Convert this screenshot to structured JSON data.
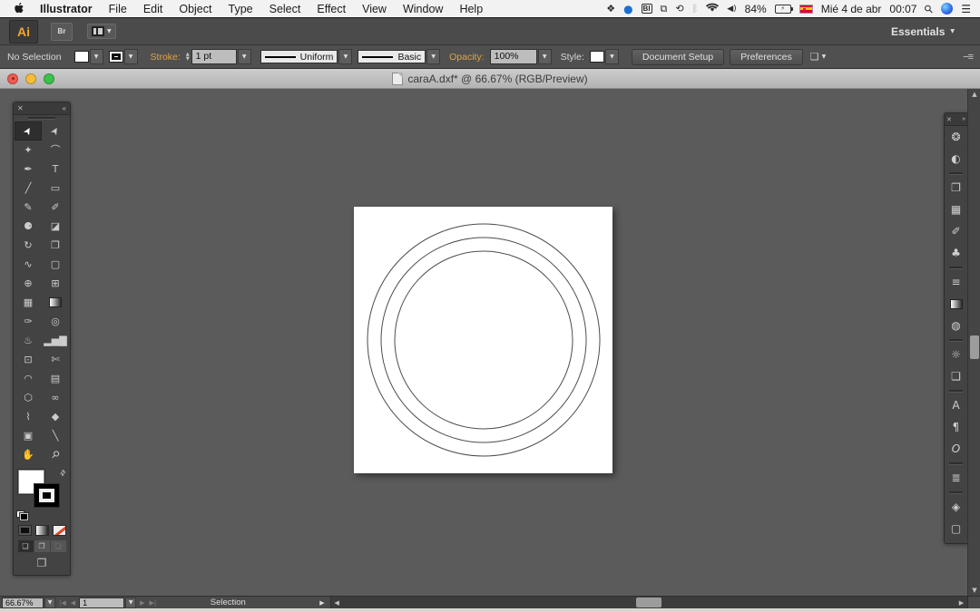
{
  "menu_bar": {
    "items": [
      "Illustrator",
      "File",
      "Edit",
      "Object",
      "Type",
      "Select",
      "Effect",
      "View",
      "Window",
      "Help"
    ],
    "status": {
      "bi": "BI",
      "battery": "84%",
      "date": "Mié 4 de abr",
      "time": "00:07",
      "icons": {
        "dropbox": "❖",
        "app": "●",
        "displays": "⧉",
        "time_machine": "⟲",
        "bluetooth": "ᛒ",
        "volume": "◀)",
        "list": "☰",
        "search": "⚲"
      }
    }
  },
  "app_bar": {
    "logo": "Ai",
    "bridge": "Br",
    "workspace_label": "Essentials"
  },
  "control_bar": {
    "no_selection": "No Selection",
    "stroke_label": "Stroke:",
    "stroke_value": "1 pt",
    "profile": "Uniform",
    "brush": "Basic",
    "opacity_label": "Opacity:",
    "opacity_value": "100%",
    "style_label": "Style:",
    "document_setup": "Document Setup",
    "preferences": "Preferences",
    "accent_color": "#e3a340"
  },
  "document": {
    "title": "caraA.dxf* @ 66.67% (RGB/Preview)"
  },
  "tools": [
    {
      "name": "selection-tool",
      "glyph": "➤",
      "rot": -60,
      "selected": true
    },
    {
      "name": "direct-selection-tool",
      "glyph": "➤",
      "rot": -60
    },
    {
      "name": "magic-wand-tool",
      "glyph": "✦"
    },
    {
      "name": "lasso-tool",
      "glyph": "⌒"
    },
    {
      "name": "pen-tool",
      "glyph": "✒"
    },
    {
      "name": "type-tool",
      "glyph": "T"
    },
    {
      "name": "line-segment-tool",
      "glyph": "╱"
    },
    {
      "name": "rectangle-tool",
      "glyph": "▭"
    },
    {
      "name": "paintbrush-tool",
      "glyph": "✎"
    },
    {
      "name": "pencil-tool",
      "glyph": "✐"
    },
    {
      "name": "blob-brush-tool",
      "glyph": "⚈"
    },
    {
      "name": "eraser-tool",
      "glyph": "◪"
    },
    {
      "name": "rotate-tool",
      "glyph": "↻"
    },
    {
      "name": "scale-tool",
      "glyph": "❐"
    },
    {
      "name": "width-tool",
      "glyph": "∿"
    },
    {
      "name": "free-transform-tool",
      "glyph": "▢"
    },
    {
      "name": "shape-builder-tool",
      "glyph": "⊕"
    },
    {
      "name": "perspective-grid-tool",
      "glyph": "⊞"
    },
    {
      "name": "mesh-tool",
      "glyph": "▦"
    },
    {
      "name": "gradient-tool",
      "kind": "gradient"
    },
    {
      "name": "eyedropper-tool",
      "glyph": "✑"
    },
    {
      "name": "blend-tool",
      "glyph": "◎"
    },
    {
      "name": "symbol-sprayer-tool",
      "glyph": "♨"
    },
    {
      "name": "column-graph-tool",
      "glyph": "▂▅▇"
    },
    {
      "name": "artboard-tool",
      "glyph": "⊡"
    },
    {
      "name": "slice-tool",
      "glyph": "✄"
    },
    {
      "name": "arc-tool",
      "glyph": "◠"
    },
    {
      "name": "measure-tool",
      "glyph": "▤"
    },
    {
      "name": "polygon-tool",
      "glyph": "⬡"
    },
    {
      "name": "ellipse-tool",
      "glyph": "∞"
    },
    {
      "name": "curvature-tool",
      "glyph": "⌇"
    },
    {
      "name": "reshape-tool",
      "glyph": "◆"
    },
    {
      "name": "transform-frame-tool",
      "glyph": "▣"
    },
    {
      "name": "knife-tool",
      "glyph": "╲"
    },
    {
      "name": "hand-tool",
      "glyph": "✋"
    },
    {
      "name": "zoom-tool",
      "glyph": "⚲",
      "rot": 45
    }
  ],
  "swatches": {
    "fill_color": "#ffffff",
    "stroke_color": "#000000"
  },
  "right_dock": {
    "groups": [
      [
        {
          "name": "color-panel-icon",
          "glyph": "❂"
        },
        {
          "name": "color-guide-panel-icon",
          "glyph": "◐"
        }
      ],
      [
        {
          "name": "pathfinder-panel-icon",
          "glyph": "❐"
        },
        {
          "name": "swatches-panel-icon",
          "glyph": "▦"
        },
        {
          "name": "brushes-panel-icon",
          "glyph": "✐"
        },
        {
          "name": "symbols-panel-icon",
          "glyph": "♣"
        }
      ],
      [
        {
          "name": "stroke-panel-icon",
          "glyph": "≡"
        },
        {
          "name": "gradient-panel-icon",
          "kind": "gradient"
        },
        {
          "name": "transparency-panel-icon",
          "glyph": "◍"
        }
      ],
      [
        {
          "name": "appearance-panel-icon",
          "glyph": "☼"
        },
        {
          "name": "graphic-styles-panel-icon",
          "glyph": "❏"
        }
      ],
      [
        {
          "name": "character-panel-icon",
          "glyph": "A"
        },
        {
          "name": "paragraph-panel-icon",
          "glyph": "¶"
        },
        {
          "name": "opentype-panel-icon",
          "glyph": "O",
          "kind": "italic"
        }
      ],
      [
        {
          "name": "align-panel-icon",
          "glyph": "≣"
        }
      ],
      [
        {
          "name": "layers-panel-icon",
          "glyph": "◈"
        },
        {
          "name": "artboards-panel-icon",
          "glyph": "▢"
        }
      ]
    ]
  },
  "canvas": {
    "circle_radii": [
      128,
      113,
      98
    ],
    "stroke_color": "#4d4d4d",
    "artboard_bg": "#ffffff"
  },
  "status_bar": {
    "zoom": "66.67%",
    "artboard": "1",
    "status": "Selection"
  },
  "ui": {
    "caret": "▼",
    "up": "▲",
    "down": "▼",
    "left": "◀",
    "right": "▶",
    "first": "|◀",
    "last": "▶|",
    "close": "✕",
    "collapse_left": "«",
    "collapse_right": "»",
    "swap": "⇄",
    "bolt": "⚡",
    "flyout": "−≡",
    "select_similar": "❏"
  }
}
